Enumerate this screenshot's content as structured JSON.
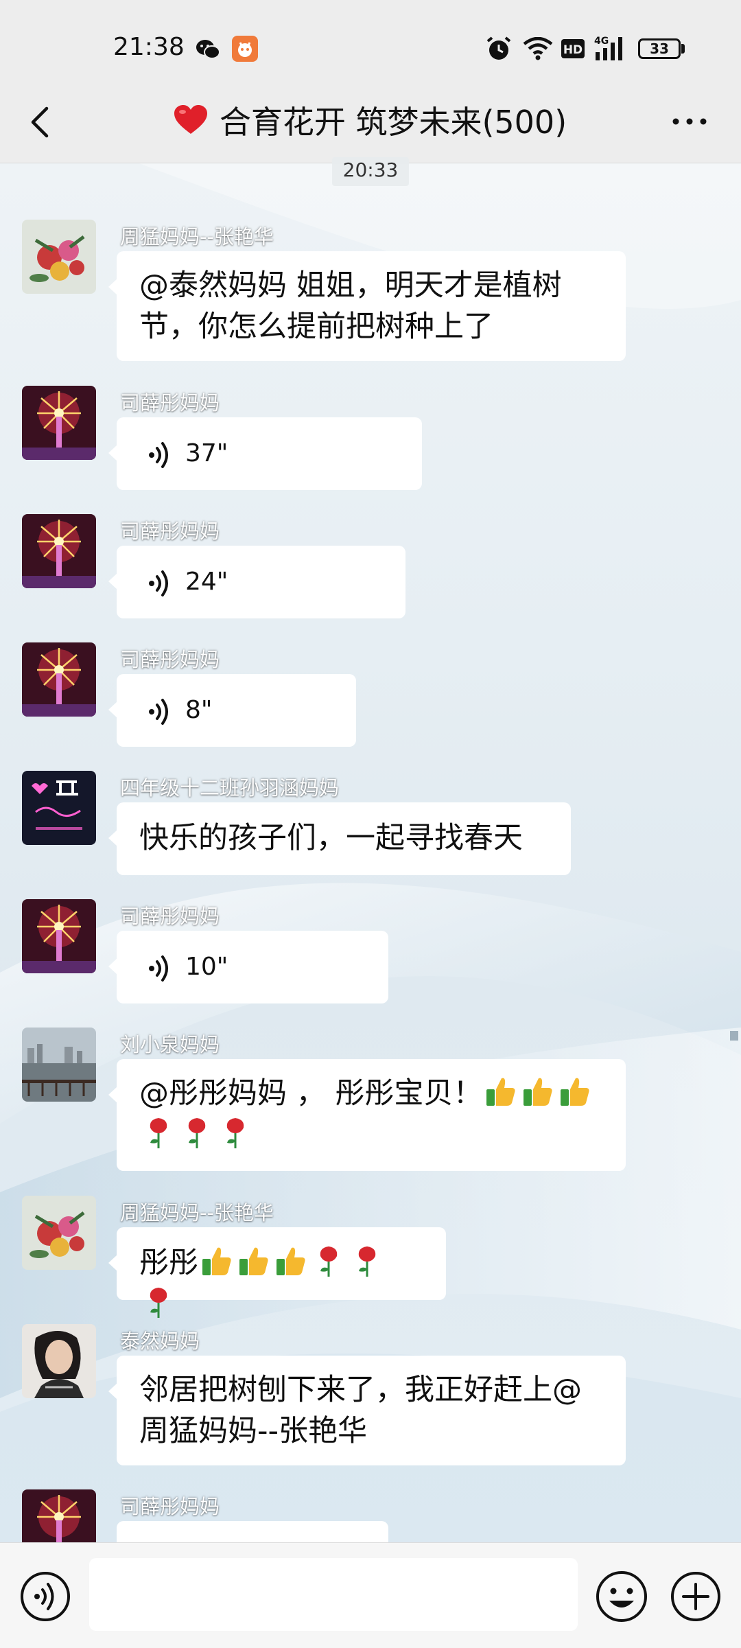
{
  "status_bar": {
    "time": "21:38",
    "battery": "33",
    "icons": [
      "wechat-icon",
      "app-notification-icon",
      "alarm-icon",
      "wifi-icon",
      "hd-icon",
      "signal-4g-icon",
      "battery-icon"
    ]
  },
  "header": {
    "title": "合育花开 筑梦未来(500)",
    "heart_icon": "red-heart-icon",
    "back_icon": "chevron-left-icon",
    "more_icon": "more-dots-icon"
  },
  "timestamp": "20:33",
  "messages": [
    {
      "sender": "周猛妈妈--张艳华",
      "type": "text",
      "text_lines": [
        "@泰然妈妈  姐姐，明天才是植树",
        "节，你怎么提前把树种上了"
      ]
    },
    {
      "sender": "司薛彤妈妈",
      "type": "voice",
      "duration": "37\""
    },
    {
      "sender": "司薛彤妈妈",
      "type": "voice",
      "duration": "24\""
    },
    {
      "sender": "司薛彤妈妈",
      "type": "voice",
      "duration": "8\""
    },
    {
      "sender": "四年级十二班孙羽涵妈妈",
      "type": "text",
      "text_lines": [
        "快乐的孩子们，一起寻找春天"
      ]
    },
    {
      "sender": "司薛彤妈妈",
      "type": "voice",
      "duration": "10\""
    },
    {
      "sender": "刘小泉妈妈",
      "type": "text",
      "text_lines": [
        "@彤彤妈妈 ， 彤彤宝贝！"
      ],
      "emojis": [
        "thumbs-up",
        "thumbs-up",
        "thumbs-up",
        "rose",
        "rose",
        "rose"
      ]
    },
    {
      "sender": "周猛妈妈--张艳华",
      "type": "text",
      "text_lines": [
        "彤彤"
      ],
      "emojis": [
        "thumbs-up",
        "thumbs-up",
        "thumbs-up",
        "rose",
        "rose",
        "rose"
      ]
    },
    {
      "sender": "泰然妈妈",
      "type": "text",
      "text_lines": [
        "邻居把树刨下来了，我正好赶上@",
        "周猛妈妈--张艳华"
      ]
    },
    {
      "sender": "司薛彤妈妈",
      "type": "voice",
      "duration": ""
    }
  ],
  "input_bar": {
    "placeholder": "",
    "voice_icon": "voice-toggle-icon",
    "emoji_icon": "emoji-icon",
    "plus_icon": "plus-icon"
  }
}
